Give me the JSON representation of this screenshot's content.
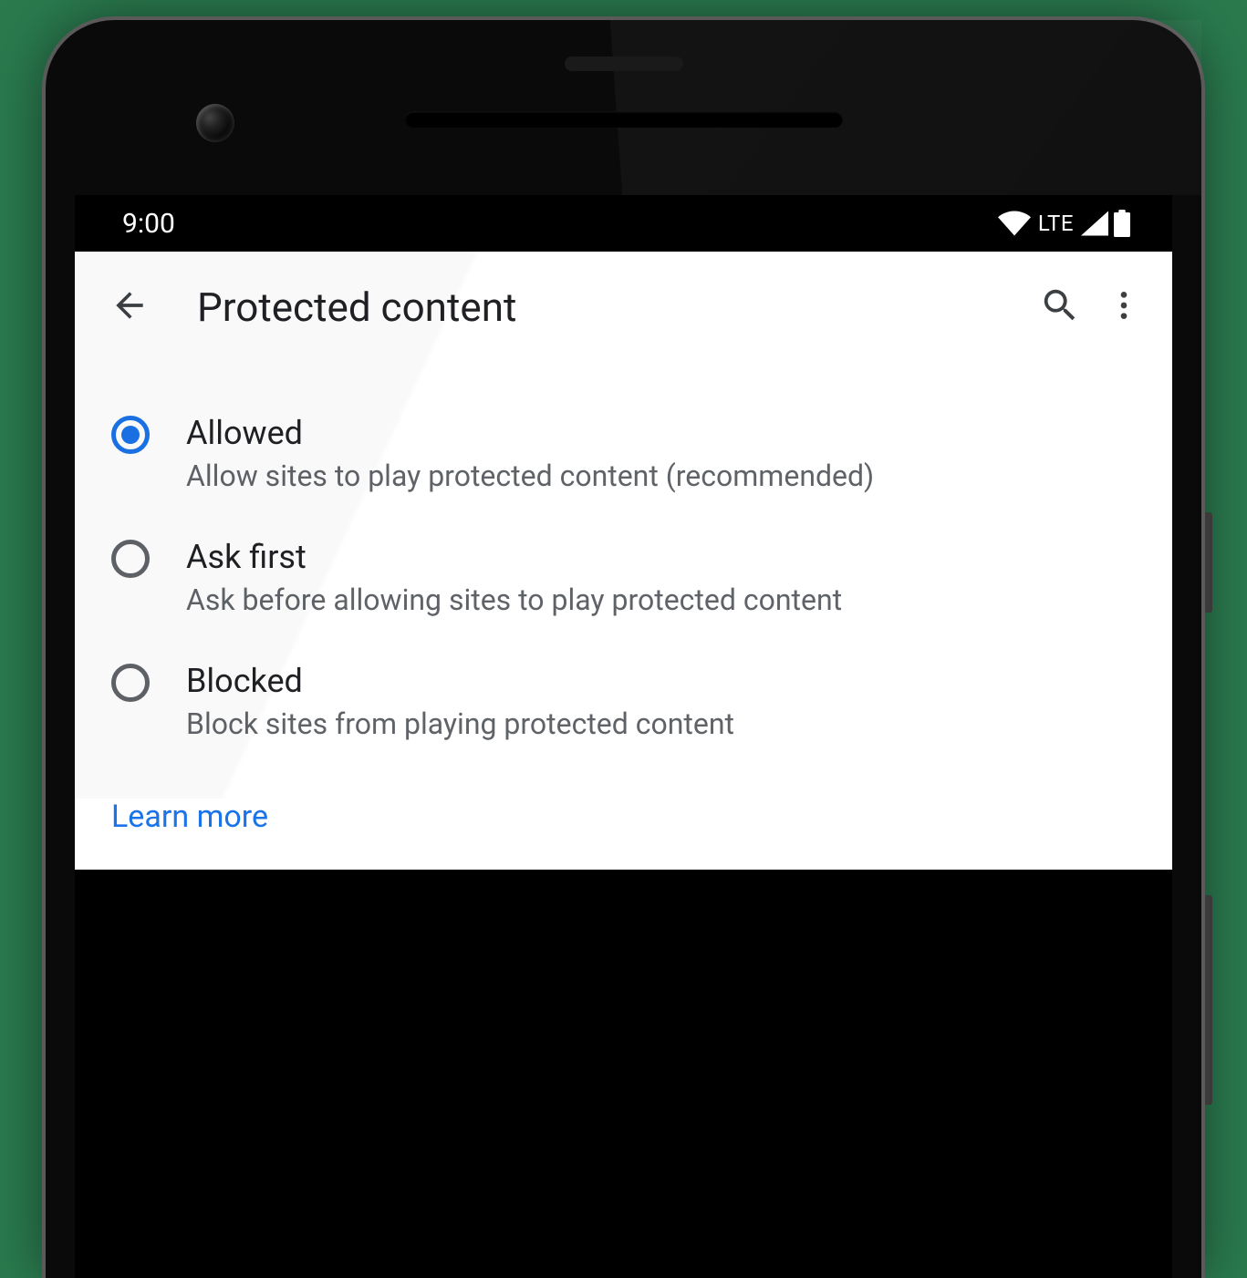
{
  "statusBar": {
    "time": "9:00",
    "network": "LTE"
  },
  "header": {
    "title": "Protected content"
  },
  "options": [
    {
      "title": "Allowed",
      "description": "Allow sites to play protected content (recommended)",
      "selected": true
    },
    {
      "title": "Ask first",
      "description": "Ask before allowing sites to play protected content",
      "selected": false
    },
    {
      "title": "Blocked",
      "description": "Block sites from playing protected content",
      "selected": false
    }
  ],
  "footer": {
    "learnMore": "Learn more"
  },
  "colors": {
    "accent": "#1a73e8",
    "textPrimary": "#202124",
    "textSecondary": "#5f6368"
  }
}
